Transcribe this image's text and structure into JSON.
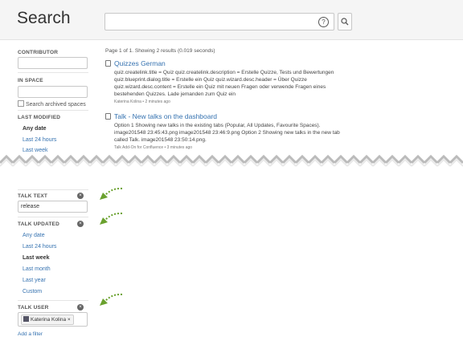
{
  "header": {
    "title": "Search",
    "search_value": ""
  },
  "sidebar": {
    "contributor_label": "CONTRIBUTOR",
    "in_space_label": "IN SPACE",
    "search_archived_label": "Search archived spaces",
    "last_modified": {
      "label": "LAST MODIFIED",
      "options": [
        "Any date",
        "Last 24 hours",
        "Last week"
      ],
      "selected": "Any date"
    },
    "talk_text": {
      "label": "TALK TEXT",
      "value": "release"
    },
    "talk_updated": {
      "label": "TALK UPDATED",
      "options": [
        "Any date",
        "Last 24 hours",
        "Last week",
        "Last month",
        "Last year",
        "Custom"
      ],
      "selected": "Last week"
    },
    "talk_user": {
      "label": "TALK USER",
      "chip": "Katerina Kolina ×"
    },
    "add_filter": "Add a filter"
  },
  "results": {
    "summary": "Page 1 of 1. Showing 2 results (0.019 seconds)",
    "items": [
      {
        "title": "Quizzes German",
        "lines": [
          "quiz.createlink.title = Quiz quiz.createlink.description = Erstelle Quizze, Tests und Bewertungen",
          "quiz.blueprint.dialog.title = Erstelle ein Quiz quiz.wizard.desc.header = Über Quizze",
          "quiz.wizard.desc.content = Erstelle ein Quiz mit neuen Fragen oder verwende Fragen eines",
          "bestehenden Quizzes. Lade jemanden zum Quiz ein"
        ],
        "meta": "Katerina Kolina • 2 minutes ago"
      },
      {
        "title": "Talk - New talks on the dashboard",
        "lines": [
          "Option 1 Showing new talks in the existing tabs (Popular, All Updates, Favourite Spaces).",
          "image201548 23:45:43.png image201548 23:46:9.png Option 2 Showing new talks in the new tab",
          "called Talk. image201548 23:50:14.png."
        ],
        "meta": "Talk Add-On for Confluence • 3 minutes ago"
      }
    ]
  },
  "colors": {
    "link": "#3572b0",
    "arrow": "#6aa12e"
  }
}
